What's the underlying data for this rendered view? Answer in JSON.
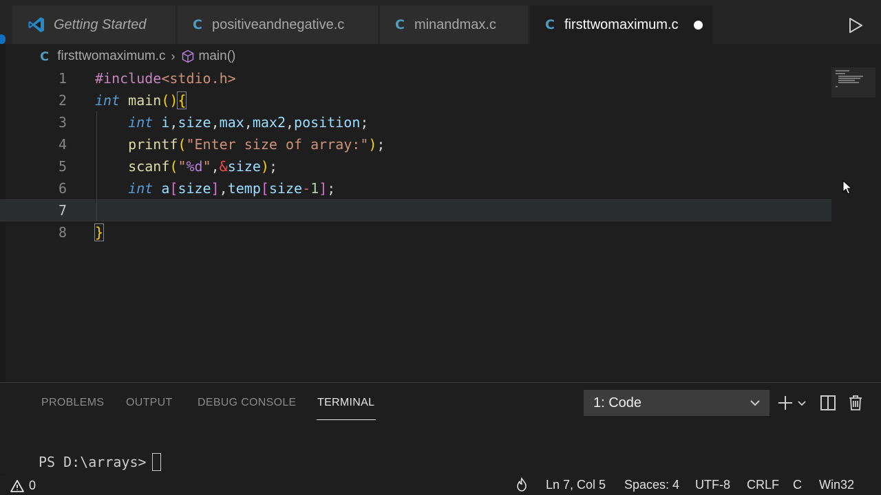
{
  "tabs": [
    {
      "label": "Getting Started",
      "icon": "vscode-logo-icon"
    },
    {
      "label": "positiveandnegative.c",
      "icon": "c-file-icon"
    },
    {
      "label": "minandmax.c",
      "icon": "c-file-icon"
    },
    {
      "label": "firsttwomaximum.c",
      "icon": "c-file-icon",
      "active": true,
      "dirty": true
    }
  ],
  "breadcrumb": {
    "file": "firsttwomaximum.c",
    "symbol": "main()"
  },
  "editor": {
    "line_numbers": [
      "1",
      "2",
      "3",
      "4",
      "5",
      "6",
      "7",
      "8"
    ],
    "current_line": 7,
    "colors": {
      "keyword": "#569cd6",
      "function": "#dcdcaa",
      "string": "#ce9178",
      "preprocessor": "#c586c0"
    }
  },
  "panel": {
    "tabs": [
      "PROBLEMS",
      "OUTPUT",
      "DEBUG CONSOLE",
      "TERMINAL"
    ],
    "active_tab": "TERMINAL",
    "terminal_select": "1: Code",
    "prompt": "PS D:\\arrays>"
  },
  "statusbar": {
    "problems_count": "0",
    "position": "Ln 7, Col 5",
    "spaces": "Spaces: 4",
    "encoding": "UTF-8",
    "eol": "CRLF",
    "language": "C",
    "platform": "Win32"
  }
}
